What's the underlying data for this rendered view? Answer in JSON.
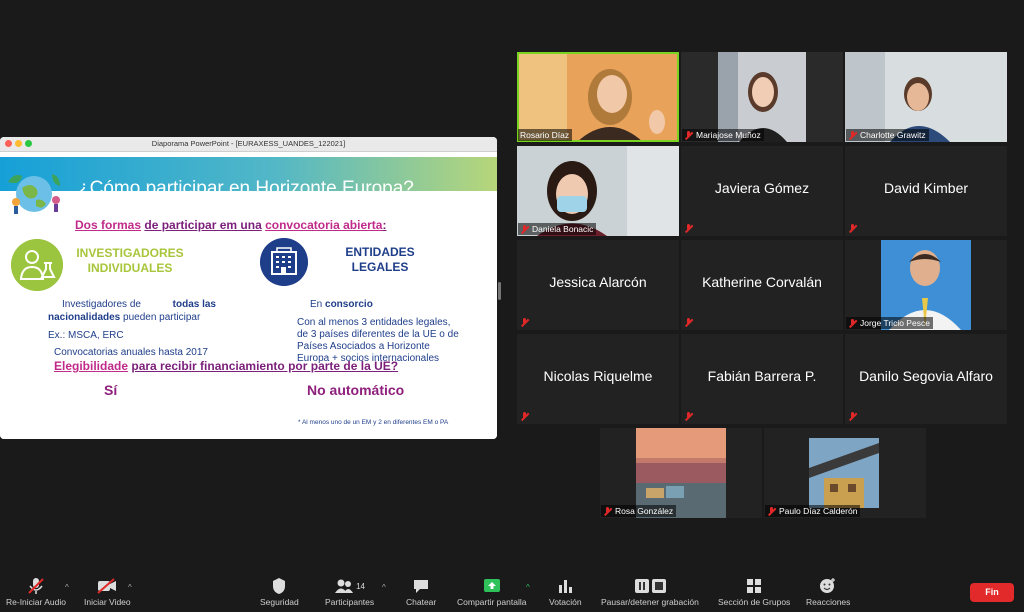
{
  "shared_window": {
    "title": "Diaporama PowerPoint - [EURAXESS_UANDES_122021]",
    "slide": {
      "title": "¿Cómo participar en Horizonte Europa?",
      "subtitle_a": "Dos formas",
      "subtitle_b": "de participar em una",
      "subtitle_c": "convocatoria abierta",
      "subtitle_d": ":",
      "left_heading_1": "INVESTIGADORES",
      "left_heading_2": "INDIVIDUALES",
      "left_line1_a": "Investigadores de",
      "left_line1_b": "todas las",
      "left_line2_a": "nacionalidades",
      "left_line2_b": "pueden participar",
      "left_line3": "Ex.: MSCA, ERC",
      "left_line4": "Convocatorias anuales hasta 2017",
      "right_heading_1": "ENTIDADES",
      "right_heading_2": "LEGALES",
      "right_line1_a": "En",
      "right_line1_b": "consorcio",
      "right_line2": "Con al menos 3 entidades legales,",
      "right_line3": "de 3 países diferentes de la UE o de",
      "right_line4": "Países Asociados a Horizonte",
      "right_line5": "Europa + socios internacionales",
      "question_a": "Elegibilidade",
      "question_b": "para recibir financiamiento por parte de la UE?",
      "answer_left": "Sí",
      "answer_right": "No automático",
      "footnote": "* Al menos uno de un EM y 2 en diferentes EM o PA"
    }
  },
  "participants": [
    {
      "name": "Rosario Díaz",
      "type": "video",
      "active": true
    },
    {
      "name": "Mariajose Muñoz",
      "type": "video"
    },
    {
      "name": "Charlotte Grawitz",
      "type": "video"
    },
    {
      "name": "Daniela Bonacic",
      "type": "video"
    },
    {
      "name": "Javiera Gómez",
      "type": "name"
    },
    {
      "name": "David Kimber",
      "type": "name"
    },
    {
      "name": "Jessica Alarcón",
      "type": "name"
    },
    {
      "name": "Katherine Corvalán",
      "type": "name"
    },
    {
      "name": "Jorge Tricio Pesce",
      "type": "video"
    },
    {
      "name": "Nicolas Riquelme",
      "type": "name"
    },
    {
      "name": "Fabián Barrera P.",
      "type": "name"
    },
    {
      "name": "Danilo Segovia Alfaro",
      "type": "name"
    },
    {
      "name": "Rosa González",
      "type": "video"
    },
    {
      "name": "Paulo Díaz Calderón",
      "type": "video"
    }
  ],
  "toolbar": {
    "audio": "Re-Iniciar Audio",
    "video": "Iniciar Video",
    "security": "Seguridad",
    "participants": "Participantes",
    "participants_count": "14",
    "chat": "Chatear",
    "share": "Compartir pantalla",
    "poll": "Votación",
    "record": "Pausar/detener grabación",
    "breakout": "Sección de Grupos",
    "reactions": "Reacciones",
    "end": "Fin"
  },
  "colors": {
    "active_speaker": "#7ad321",
    "share_green": "#2fc25b",
    "end_red": "#e22a2a",
    "muted_red": "#e02828"
  }
}
